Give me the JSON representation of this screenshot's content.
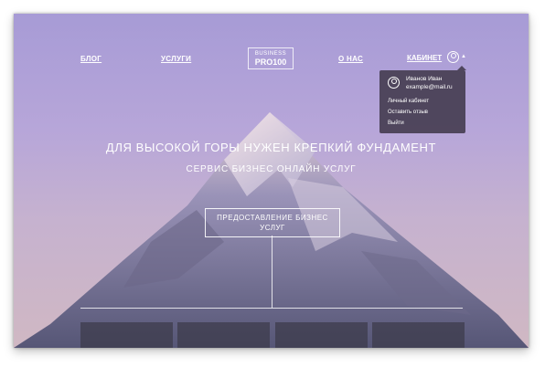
{
  "nav": {
    "blog": "БЛОГ",
    "services": "УСЛУГИ",
    "about": "О НАС",
    "cabinet": "КАБИНЕТ"
  },
  "logo": {
    "line1": "BUSINESS",
    "line2": "PRO100"
  },
  "dropdown": {
    "name": "Иванов Иван",
    "email": "example@mail.ru",
    "links": [
      "Личный кабинет",
      "Оставить отзыв",
      "Выйти"
    ]
  },
  "hero": {
    "title": "ДЛЯ ВЫСОКОЙ ГОРЫ НУЖЕН КРЕПКИЙ ФУНДАМЕНТ",
    "subtitle": "СЕРВИС БИЗНЕС ОНЛАЙН УСЛУГ",
    "cta": "ПРЕДОСТАВЛЕНИЕ БИЗНЕС УСЛУГ"
  },
  "icons": {
    "user": "user-circle-icon",
    "caret": "chevron-up-icon"
  }
}
